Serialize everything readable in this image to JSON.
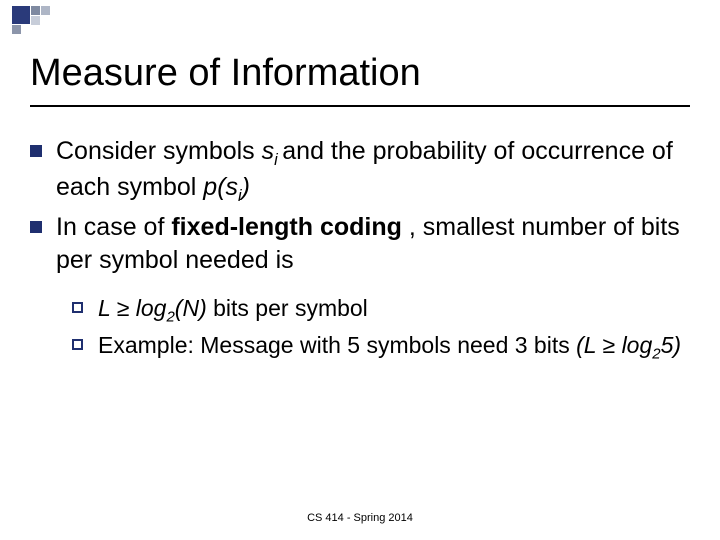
{
  "title": "Measure of Information",
  "bullets": [
    {
      "pre": "Consider symbols ",
      "sym1": "s",
      "sub1": "i ",
      "mid1": "and the probability of occurrence of each symbol ",
      "psi": "p(s",
      "sub2": "i",
      "close": ")"
    },
    {
      "text1": "In case of ",
      "bold": "fixed-length coding ",
      "text2": ", smallest number of bits per symbol needed is"
    }
  ],
  "sub_bullets": [
    {
      "lead": " ",
      "L": "L ≥ log",
      "base": "2",
      "N": "(N)",
      "rest": " bits per symbol"
    },
    {
      "head": "Example:",
      "body1": " Message with 5 symbols need  3 bits ",
      "paren_open": "(L ≥ log",
      "base": "2",
      "five": "5)"
    }
  ],
  "footer": "CS 414 - Spring 2014"
}
